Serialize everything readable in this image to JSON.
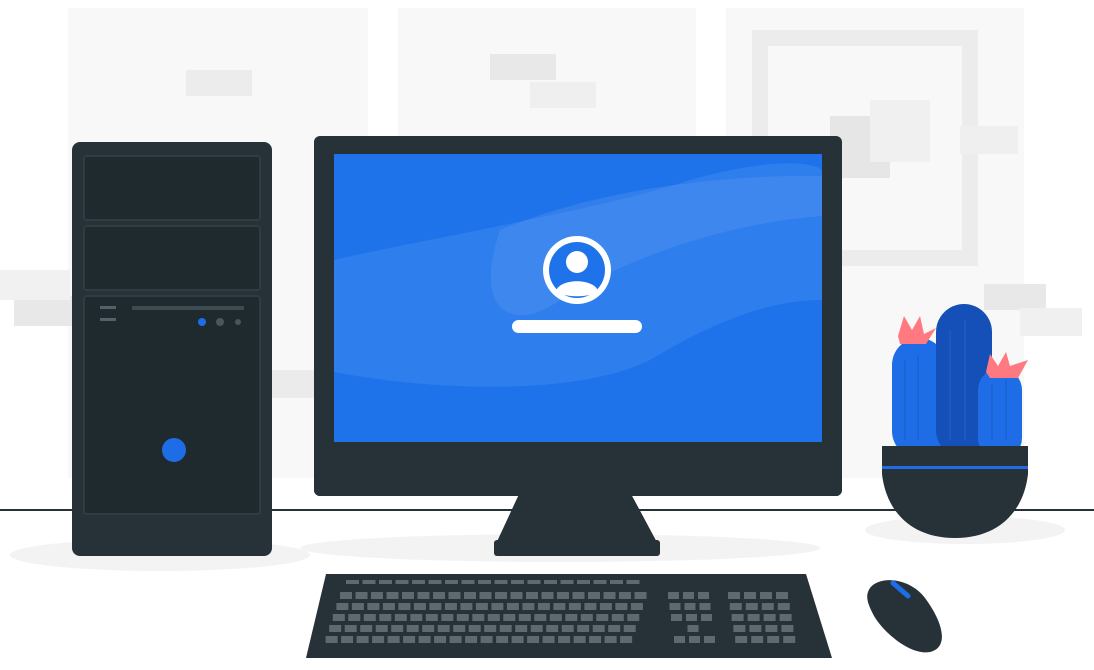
{
  "scene": {
    "caption": "",
    "colors": {
      "background": "#ffffff",
      "wall_panel": "#f7f7f7",
      "wall_block": "#ebebeb",
      "floor_shadow": "#f2f2f2",
      "desk_line": "#263238",
      "dark": "#263238",
      "dark_panel": "#1e2a30",
      "accent_blue": "#1e6de6",
      "screen_blue": "#1f73ea",
      "screen_highlight": "#4a8ff2",
      "key_grey": "#5f6a70",
      "cactus_blue": "#1e6de6",
      "cactus_dark": "#1550b8",
      "flower_pink": "#ff7a80"
    },
    "objects": {
      "computer_tower": "computer-tower",
      "monitor": "monitor",
      "login_screen": "login-screen",
      "user_icon": "user-avatar-icon",
      "password_field": "login-field-bar",
      "keyboard": "keyboard",
      "mouse": "mouse",
      "cactus_pot": "cactus-pot",
      "picture_frame": "picture-frame"
    }
  }
}
